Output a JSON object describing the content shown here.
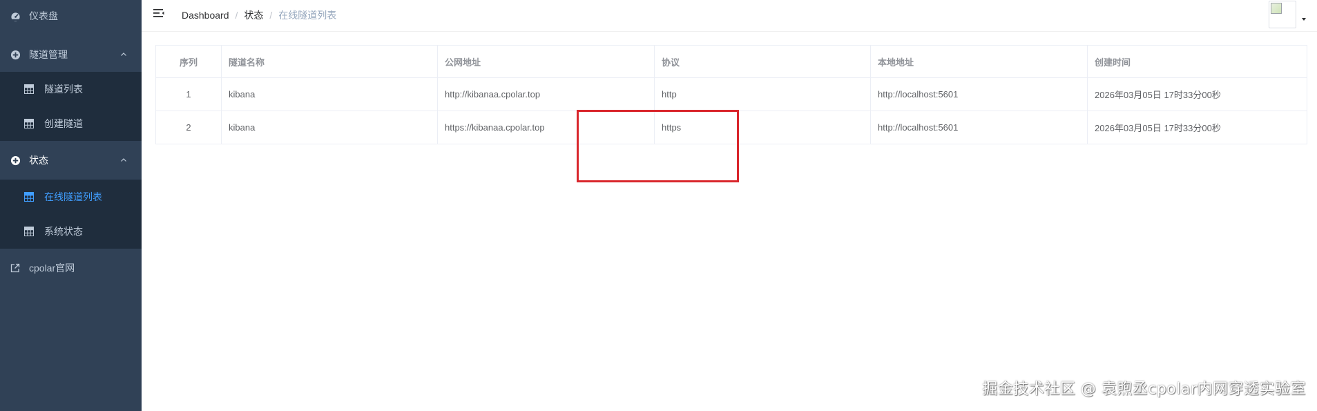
{
  "sidebar": {
    "items": [
      {
        "label": "仪表盘",
        "icon": "dashboard-icon"
      },
      {
        "label": "隧道管理",
        "icon": "plus-circle-icon",
        "expanded": true,
        "children": [
          {
            "label": "隧道列表",
            "icon": "grid-icon"
          },
          {
            "label": "创建隧道",
            "icon": "grid-icon"
          }
        ]
      },
      {
        "label": "状态",
        "icon": "plus-circle-icon",
        "expanded": true,
        "children": [
          {
            "label": "在线隧道列表",
            "icon": "grid-icon",
            "active": true
          },
          {
            "label": "系统状态",
            "icon": "grid-icon"
          }
        ]
      },
      {
        "label": "cpolar官网",
        "icon": "external-link-icon"
      }
    ]
  },
  "header": {
    "breadcrumb": [
      "Dashboard",
      "状态",
      "在线隧道列表"
    ],
    "separator": "/"
  },
  "table": {
    "columns": [
      "序列",
      "隧道名称",
      "公网地址",
      "协议",
      "本地地址",
      "创建时间"
    ],
    "rows": [
      [
        "1",
        "kibana",
        "http://kibanaa.cpolar.top",
        "http",
        "http://localhost:5601",
        "2026年03月05日 17时33分00秒"
      ],
      [
        "2",
        "kibana",
        "https://kibanaa.cpolar.top",
        "https",
        "http://localhost:5601",
        "2026年03月05日 17时33分00秒"
      ]
    ]
  },
  "watermark": "掘金技术社区 @ 袁煦丞cpolar内网穿透实验室",
  "colors": {
    "sidebar_bg": "#304156",
    "submenu_bg": "#1f2d3d",
    "active": "#409eff",
    "highlight": "#d9262c"
  }
}
